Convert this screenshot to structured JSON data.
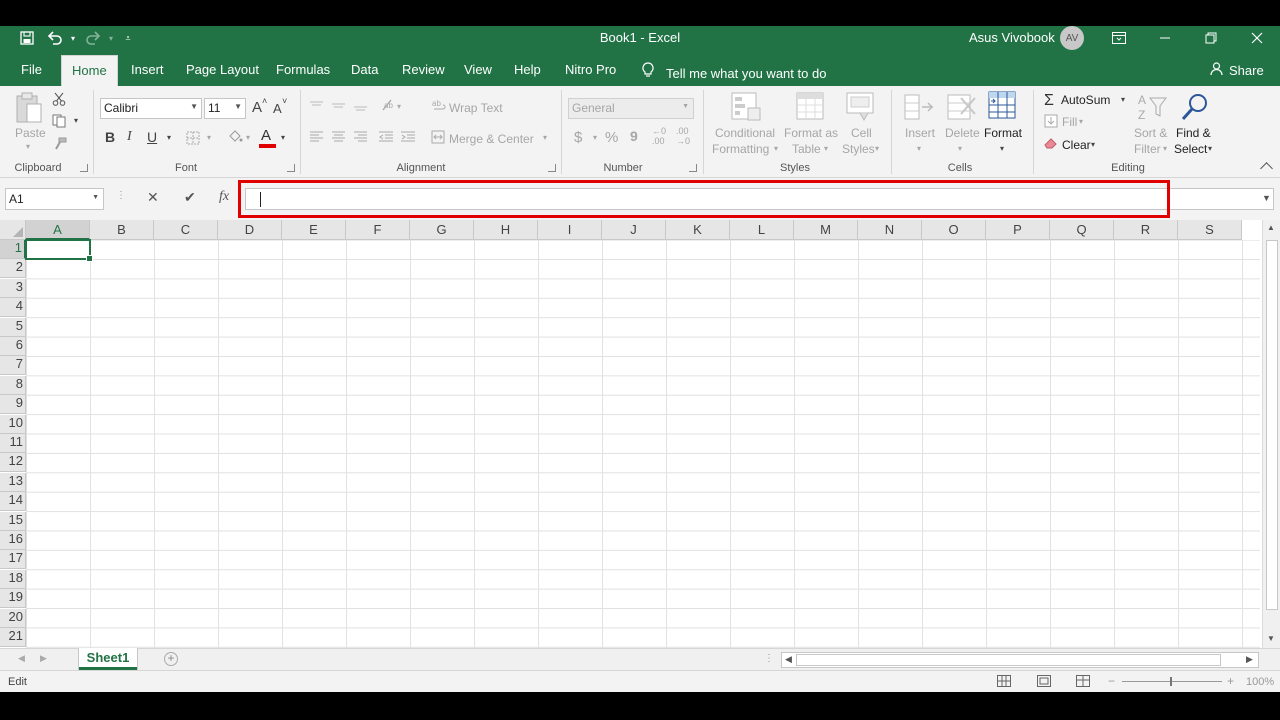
{
  "window": {
    "title": "Book1  -  Excel",
    "user_name": "Asus Vivobook",
    "user_initials": "AV"
  },
  "quick_access": {
    "save_icon": "save-icon",
    "undo_icon": "undo-icon",
    "redo_icon": "redo-icon",
    "customize_icon": "customize-qat-icon"
  },
  "tabs": [
    "File",
    "Home",
    "Insert",
    "Page Layout",
    "Formulas",
    "Data",
    "Review",
    "View",
    "Help",
    "Nitro Pro"
  ],
  "active_tab": "Home",
  "tell_me": "Tell me what you want to do",
  "share_label": "Share",
  "ribbon": {
    "clipboard": {
      "paste": "Paste",
      "label": "Clipboard"
    },
    "font": {
      "name": "Calibri",
      "size": "11",
      "bold": "B",
      "italic": "I",
      "underline": "U",
      "label": "Font",
      "grow": "A",
      "shrink": "A",
      "font_color": "A"
    },
    "alignment": {
      "wrap_text": "Wrap Text",
      "merge_center": "Merge & Center",
      "label": "Alignment"
    },
    "number": {
      "format": "General",
      "currency": "$",
      "percent": "%",
      "comma": "9",
      "inc_dec": ".00",
      "dec_dec": ".00",
      "label": "Number"
    },
    "styles": {
      "conditional_1": "Conditional",
      "conditional_2": "Formatting",
      "format_table_1": "Format as",
      "format_table_2": "Table",
      "cell_styles_1": "Cell",
      "cell_styles_2": "Styles",
      "label": "Styles"
    },
    "cells": {
      "insert": "Insert",
      "delete": "Delete",
      "format": "Format",
      "label": "Cells"
    },
    "editing": {
      "autosum": "AutoSum",
      "fill": "Fill",
      "clear": "Clear",
      "sort_1": "Sort &",
      "sort_2": "Filter",
      "find_1": "Find &",
      "find_2": "Select",
      "label": "Editing"
    }
  },
  "formula_bar": {
    "name_box": "A1",
    "fx": "fx",
    "cancel": "✕",
    "enter": "✔",
    "value": ""
  },
  "grid": {
    "columns": [
      "A",
      "B",
      "C",
      "D",
      "E",
      "F",
      "G",
      "H",
      "I",
      "J",
      "K",
      "L",
      "M",
      "N",
      "O",
      "P",
      "Q",
      "R",
      "S"
    ],
    "rows": [
      "1",
      "2",
      "3",
      "4",
      "5",
      "6",
      "7",
      "8",
      "9",
      "10",
      "11",
      "12",
      "13",
      "14",
      "15",
      "16",
      "17",
      "18",
      "19",
      "20",
      "21"
    ],
    "active_cell": "A1"
  },
  "sheets": [
    "Sheet1"
  ],
  "status": {
    "mode": "Edit",
    "zoom": "100%",
    "zoom_minus": "−",
    "zoom_plus": "+"
  },
  "colors": {
    "accent": "#217346",
    "highlight": "#e00000"
  }
}
